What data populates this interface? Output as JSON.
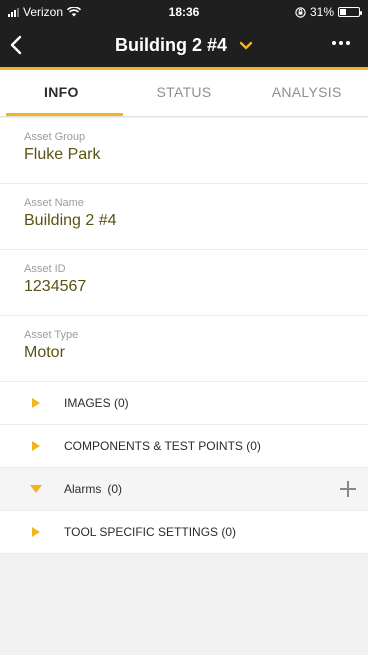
{
  "status_bar": {
    "carrier": "Verizon",
    "time": "18:36",
    "battery": "31%",
    "battery_level": 0.31
  },
  "nav": {
    "title": "Building 2 #4",
    "back_icon": "chevron-left-icon",
    "menu_icon": "ellipsis-icon"
  },
  "tabs": [
    {
      "label": "INFO",
      "active": true
    },
    {
      "label": "STATUS",
      "active": false
    },
    {
      "label": "ANALYSIS",
      "active": false
    }
  ],
  "fields": [
    {
      "label": "Asset Group",
      "value": "Fluke Park"
    },
    {
      "label": "Asset Name",
      "value": "Building 2 #4"
    },
    {
      "label": "Asset ID",
      "value": "1234567"
    },
    {
      "label": "Asset Type",
      "value": "Motor"
    }
  ],
  "sections": [
    {
      "label": "IMAGES (0)",
      "expanded": false
    },
    {
      "label": "COMPONENTS & TEST POINTS (0)",
      "expanded": false
    },
    {
      "label": "Alarms",
      "count": "(0)",
      "expanded": true
    },
    {
      "label": "TOOL SPECIFIC SETTINGS (0)",
      "expanded": false
    }
  ],
  "colors": {
    "accent": "#f2b51f",
    "header_bg": "#1f1f1f",
    "value_text": "#5a5213"
  }
}
